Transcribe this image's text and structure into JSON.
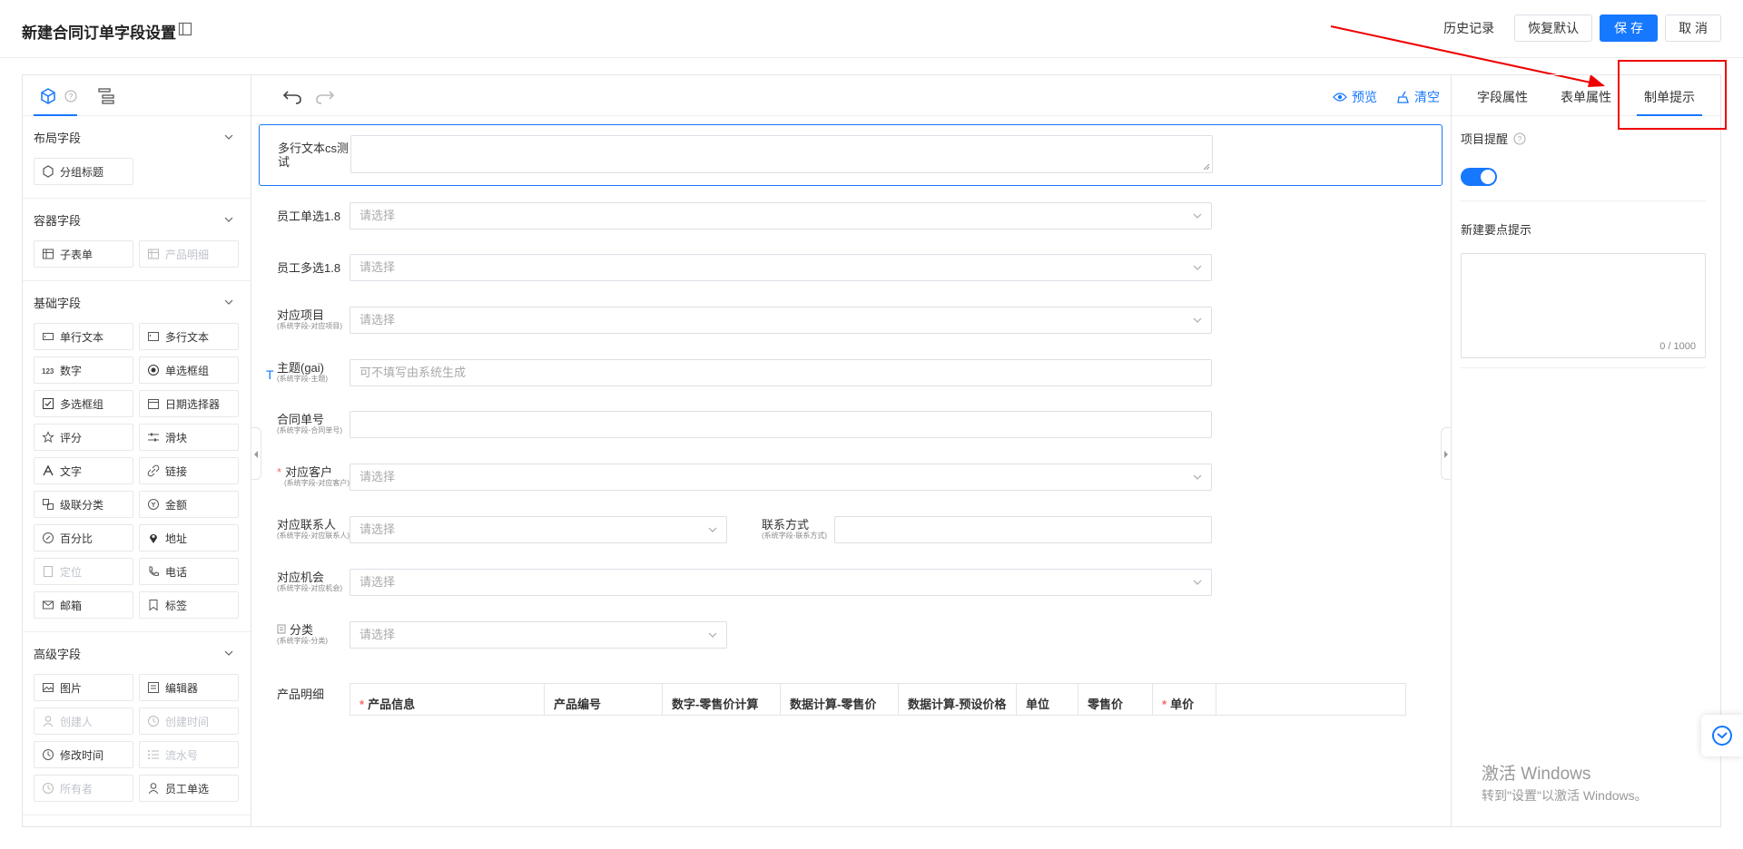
{
  "header": {
    "title": "新建合同订单字段设置",
    "history": "历史记录",
    "restore": "恢复默认",
    "save": "保 存",
    "cancel": "取 消"
  },
  "left": {
    "groups": [
      {
        "title": "布局字段",
        "items": [
          {
            "label": "分组标题",
            "icon": "group-title-icon"
          }
        ]
      },
      {
        "title": "容器字段",
        "items": [
          {
            "label": "子表单",
            "icon": "table-icon"
          },
          {
            "label": "产品明细",
            "icon": "table-icon",
            "disabled": true
          }
        ]
      },
      {
        "title": "基础字段",
        "items": [
          {
            "label": "单行文本",
            "icon": "single-line-icon"
          },
          {
            "label": "多行文本",
            "icon": "multi-line-icon"
          },
          {
            "label": "数字",
            "icon": "number-icon"
          },
          {
            "label": "单选框组",
            "icon": "radio-icon"
          },
          {
            "label": "多选框组",
            "icon": "checkbox-icon"
          },
          {
            "label": "日期选择器",
            "icon": "calendar-icon"
          },
          {
            "label": "评分",
            "icon": "star-icon"
          },
          {
            "label": "滑块",
            "icon": "slider-icon"
          },
          {
            "label": "文字",
            "icon": "text-icon"
          },
          {
            "label": "链接",
            "icon": "link-icon"
          },
          {
            "label": "级联分类",
            "icon": "cascade-icon"
          },
          {
            "label": "金额",
            "icon": "money-icon"
          },
          {
            "label": "百分比",
            "icon": "percent-icon"
          },
          {
            "label": "地址",
            "icon": "location-icon"
          },
          {
            "label": "定位",
            "icon": "position-icon",
            "disabled": true
          },
          {
            "label": "电话",
            "icon": "phone-icon"
          },
          {
            "label": "邮箱",
            "icon": "mail-icon"
          },
          {
            "label": "标签",
            "icon": "tag-icon"
          }
        ]
      },
      {
        "title": "高级字段",
        "items": [
          {
            "label": "图片",
            "icon": "image-icon"
          },
          {
            "label": "编辑器",
            "icon": "editor-icon"
          },
          {
            "label": "创建人",
            "icon": "user-icon",
            "disabled": true
          },
          {
            "label": "创建时间",
            "icon": "clock-icon",
            "disabled": true
          },
          {
            "label": "修改时间",
            "icon": "clock-icon"
          },
          {
            "label": "流水号",
            "icon": "serial-icon",
            "disabled": true
          },
          {
            "label": "所有者",
            "icon": "clock-icon",
            "disabled": true
          },
          {
            "label": "员工单选",
            "icon": "user-icon"
          }
        ]
      }
    ]
  },
  "toolbar": {
    "preview": "预览",
    "clear": "清空"
  },
  "form": {
    "multiline_label": "多行文本cs测试",
    "emp_single": {
      "label": "员工单选1.8",
      "placeholder": "请选择"
    },
    "emp_multi": {
      "label": "员工多选1.8",
      "placeholder": "请选择"
    },
    "project": {
      "label": "对应项目",
      "sub": "(系统字段-对应项目)",
      "placeholder": "请选择"
    },
    "subject": {
      "label": "主题(gai)",
      "sub": "(系统字段-主题)",
      "placeholder": "可不填写由系统生成"
    },
    "contract_no": {
      "label": "合同单号",
      "sub": "(系统字段-合同单号)"
    },
    "customer": {
      "req": "*",
      "label": "对应客户",
      "sub": "(系统字段-对应客户)",
      "placeholder": "请选择"
    },
    "contact": {
      "label": "对应联系人",
      "sub": "(系统字段-对应联系人)",
      "placeholder": "请选择"
    },
    "contact_way": {
      "label": "联系方式",
      "sub": "(系统字段-联系方式)"
    },
    "opportunity": {
      "label": "对应机会",
      "sub": "(系统字段-对应机会)",
      "placeholder": "请选择"
    },
    "category": {
      "label": "分类",
      "sub": "(系统字段-分类)",
      "placeholder": "请选择"
    },
    "product_detail": {
      "label": "产品明细"
    },
    "text_marker": "T",
    "table_headers": [
      "产品信息",
      "产品编号",
      "数字-零售价计算",
      "数据计算-零售价",
      "数据计算-预设价格",
      "单位",
      "零售价",
      "单价"
    ]
  },
  "right": {
    "tabs": [
      "字段属性",
      "表单属性",
      "制单提示"
    ],
    "project_remind": "项目提醒",
    "new_tip": "新建要点提示",
    "counter": "0 / 1000"
  },
  "watermark": {
    "line1": "激活 Windows",
    "line2": "转到\"设置\"以激活 Windows。"
  }
}
